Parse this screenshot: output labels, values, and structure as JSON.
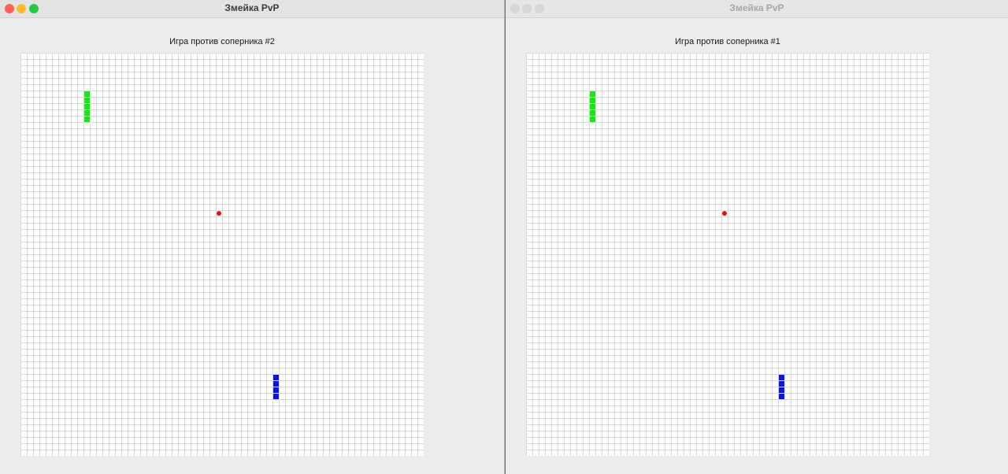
{
  "colors": {
    "snake_green": "#19e619",
    "snake_blue": "#0a18d8",
    "food": "#e01010",
    "close_button": "#fe5f57",
    "minimize_button": "#febb2e",
    "maximize_button": "#28c840",
    "inactive_button": "#d6d6d6"
  },
  "windows": [
    {
      "title": "Змейка PvP",
      "state": "active",
      "heading": "Игра против соперника #2"
    },
    {
      "title": "Змейка PvP",
      "state": "inactive",
      "heading": "Игра против соперника #1"
    }
  ],
  "board": {
    "columns": 64,
    "rows": 64,
    "green_snake": [
      [
        10,
        6
      ],
      [
        10,
        7
      ],
      [
        10,
        8
      ],
      [
        10,
        9
      ],
      [
        10,
        10
      ]
    ],
    "blue_snake": [
      [
        40,
        51
      ],
      [
        40,
        52
      ],
      [
        40,
        53
      ],
      [
        40,
        54
      ]
    ],
    "food": [
      31,
      25
    ]
  },
  "icons": {
    "close": "close-icon",
    "minimize": "minimize-icon",
    "maximize": "maximize-icon"
  }
}
